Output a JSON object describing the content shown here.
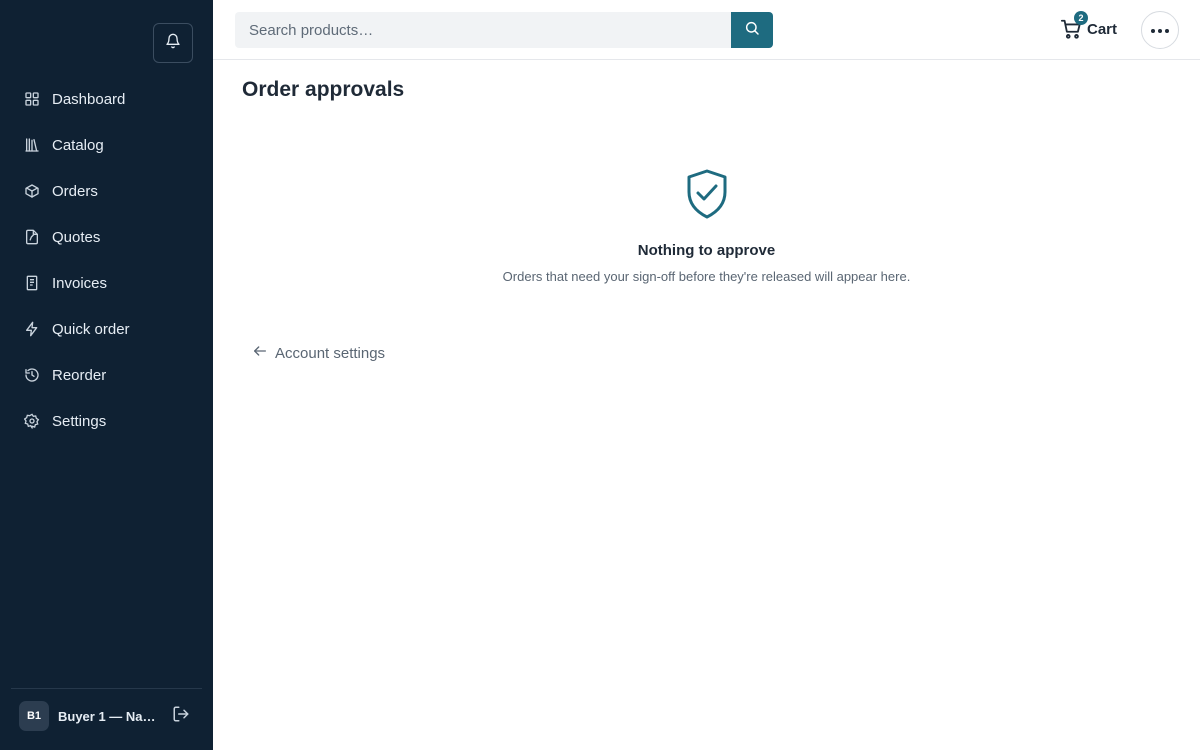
{
  "sidebar": {
    "notifications_icon": "bell-icon",
    "items": [
      {
        "label": "Dashboard",
        "icon": "dashboard-grid-icon"
      },
      {
        "label": "Catalog",
        "icon": "catalog-books-icon"
      },
      {
        "label": "Orders",
        "icon": "box-icon"
      },
      {
        "label": "Quotes",
        "icon": "quote-document-icon"
      },
      {
        "label": "Invoices",
        "icon": "receipt-icon"
      },
      {
        "label": "Quick order",
        "icon": "lightning-icon"
      },
      {
        "label": "Reorder",
        "icon": "history-icon"
      },
      {
        "label": "Settings",
        "icon": "gear-icon"
      }
    ],
    "user": {
      "initials": "B1",
      "name": "Buyer 1 — Nair…",
      "logout_icon": "logout-icon"
    }
  },
  "topbar": {
    "search": {
      "placeholder": "Search products…",
      "value": ""
    },
    "cart": {
      "label": "Cart",
      "count": "2"
    }
  },
  "main": {
    "title": "Order approvals",
    "empty_state": {
      "icon": "shield-check-icon",
      "title": "Nothing to approve",
      "subtitle": "Orders that need your sign-off before they're released will appear here."
    },
    "back_link": {
      "label": "Account settings",
      "icon": "arrow-left-icon"
    }
  },
  "colors": {
    "sidebar_bg": "#0f2133",
    "accent": "#1e6b80",
    "text": "#1f2a37",
    "muted": "#5a6673"
  }
}
